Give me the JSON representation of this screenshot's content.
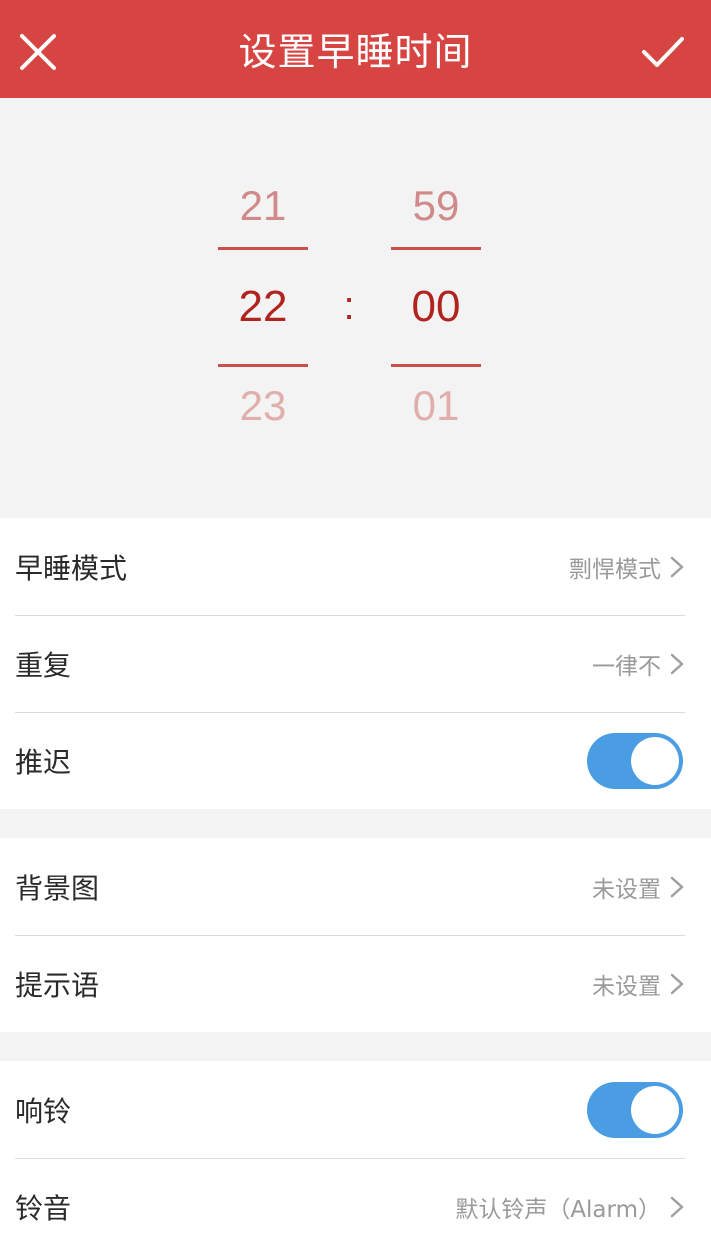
{
  "header": {
    "title": "设置早睡时间",
    "close_icon": "close-icon",
    "confirm_icon": "checkmark-icon",
    "color": "#d64541"
  },
  "time_picker": {
    "hour": {
      "prev": "21",
      "current": "22",
      "next": "23"
    },
    "separator": ":",
    "minute": {
      "prev": "59",
      "current": "00",
      "next": "01"
    },
    "accent": "#b0231e"
  },
  "settings": {
    "mode": {
      "label": "早睡模式",
      "value": "剽悍模式"
    },
    "repeat": {
      "label": "重复",
      "value": "一律不"
    },
    "snooze": {
      "label": "推迟",
      "enabled": true
    },
    "background": {
      "label": "背景图",
      "value": "未设置"
    },
    "prompt": {
      "label": "提示语",
      "value": "未设置"
    },
    "ring": {
      "label": "响铃",
      "enabled": true
    },
    "ringtone": {
      "label": "铃音",
      "value": "默认铃声（Alarm）"
    }
  },
  "toggle_color": "#4a9de3"
}
